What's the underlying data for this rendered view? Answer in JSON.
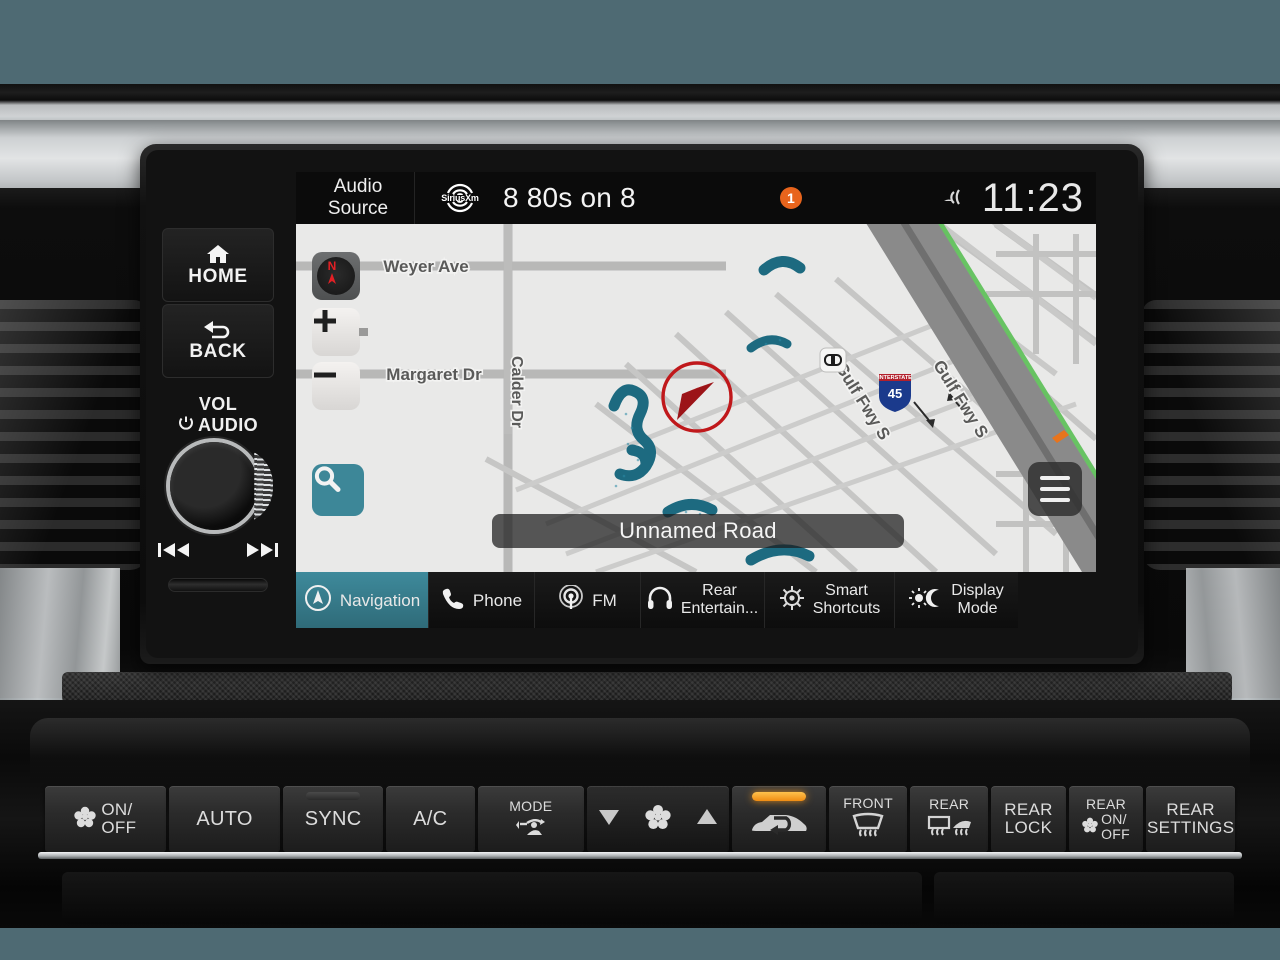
{
  "status_bar": {
    "audio_source_label": "Audio\nSource",
    "audio_source_line1": "Audio",
    "audio_source_line2": "Source",
    "provider_logo": "SiriusXm",
    "station": "8 80s on 8",
    "notification_badge": "1",
    "notification_color": "#e8641c",
    "signal_icon": "signal-wave-icon",
    "clock": "11:23"
  },
  "map": {
    "background_color": "#dededd",
    "road_color": "#b4b4b3",
    "highway_color": "#7c7c7c",
    "water_color": "#1d6a80",
    "greenway_color": "#5fbf5a",
    "current_road": "Unnamed Road",
    "street_labels": [
      "Weyer Ave",
      "Margaret Dr",
      "Calder Dr",
      "Gulf Fwy S",
      "Gulf Fwy S"
    ],
    "highway_shield": {
      "top_text": "INTERSTATE",
      "number": "45",
      "color": "#1b3a8c",
      "crest_color": "#b3202c"
    },
    "poi_marker": "honda-dealer-icon",
    "vehicle_marker": {
      "name": "vehicle-position-arrow",
      "ring_color": "#c0181b",
      "arrow_color": "#9c1418"
    },
    "controls": {
      "compass_label": "N",
      "compass_name": "compass-north-icon",
      "zoom_in": "+",
      "zoom_out": "−",
      "search_icon": "search-icon",
      "search_color": "#3d8798",
      "menu_icon": "hamburger-menu-icon"
    }
  },
  "tabs": [
    {
      "label": "Navigation",
      "icon": "navigation-compass-icon",
      "active": true,
      "lines": 1
    },
    {
      "label": "Phone",
      "icon": "phone-handset-icon",
      "active": false,
      "lines": 1
    },
    {
      "label": "FM",
      "icon": "radio-broadcast-icon",
      "active": false,
      "lines": 1
    },
    {
      "label_line1": "Rear",
      "label_line2": "Entertain...",
      "icon": "headphones-icon",
      "active": false,
      "lines": 2
    },
    {
      "label_line1": "Smart",
      "label_line2": "Shortcuts",
      "icon": "ship-wheel-icon",
      "active": false,
      "lines": 2
    },
    {
      "label_line1": "Display",
      "label_line2": "Mode",
      "icon": "sun-moon-icon",
      "active": false,
      "lines": 2
    }
  ],
  "hard_keys": {
    "home": {
      "label": "HOME",
      "icon": "house-icon"
    },
    "back": {
      "label": "BACK",
      "icon": "back-arrow-icon"
    },
    "volume": {
      "line1": "VOL",
      "line2": "AUDIO",
      "icon": "power-icon"
    },
    "knob": "volume-knob",
    "prev_track": "previous-track-icon",
    "next_track": "next-track-icon",
    "disc_slot": "disc-slot"
  },
  "climate": [
    {
      "name": "fan-on-off",
      "label": "ON/\nOFF",
      "line1": "ON/",
      "line2": "OFF",
      "icon": "fan-icon"
    },
    {
      "name": "auto",
      "label": "AUTO"
    },
    {
      "name": "sync",
      "label": "SYNC"
    },
    {
      "name": "ac",
      "label": "A/C"
    },
    {
      "name": "mode",
      "label": "MODE",
      "icon": "airflow-mode-icon"
    },
    {
      "name": "fan-down",
      "label": "",
      "icon": "triangle-down-icon"
    },
    {
      "name": "fan-speed",
      "label": "",
      "icon": "fan-icon"
    },
    {
      "name": "fan-up",
      "label": "",
      "icon": "triangle-up-icon"
    },
    {
      "name": "recirculation",
      "label": "",
      "icon": "air-recirculation-icon",
      "indicator_on": true,
      "indicator_color": "#f5961a"
    },
    {
      "name": "front-defrost",
      "label": "FRONT",
      "icon": "front-defrost-icon"
    },
    {
      "name": "rear-defrost",
      "label": "REAR",
      "icon": "rear-defrost-icon"
    },
    {
      "name": "rear-lock",
      "label": "REAR\nLOCK",
      "line1": "REAR",
      "line2": "LOCK"
    },
    {
      "name": "rear-fan-on-off",
      "label": "REAR\nON/\nOFF",
      "line1": "REAR",
      "line2": "ON/",
      "line3": "OFF",
      "icon": "fan-icon"
    },
    {
      "name": "rear-settings",
      "label": "REAR\nSETTINGS",
      "line1": "REAR",
      "line2": "SETTINGS"
    }
  ],
  "theme": {
    "background": "#4e6a73",
    "accent_teal": "#3d8798",
    "active_tab": "#3e8a9b",
    "badge_orange": "#e8641c",
    "led_amber": "#f5961a"
  }
}
